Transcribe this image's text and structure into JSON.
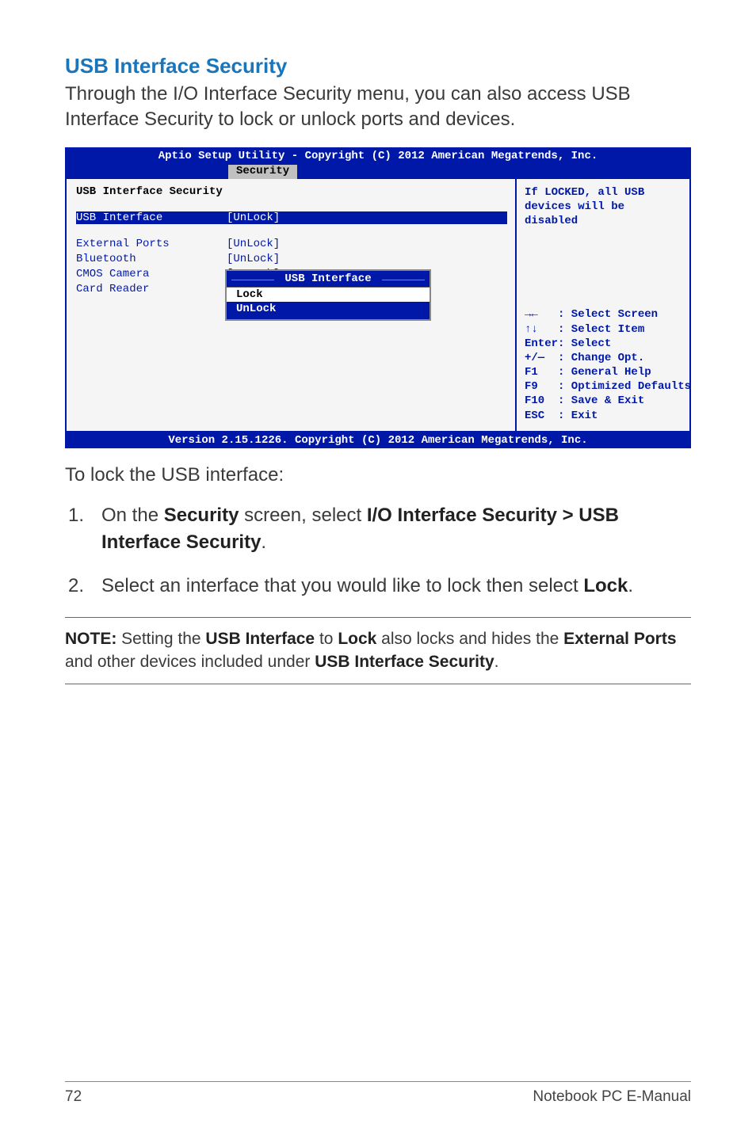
{
  "heading": "USB Interface Security",
  "intro": "Through the I/O Interface Security menu, you can also access USB Interface Security to lock or unlock ports and devices.",
  "bios": {
    "topline": "Aptio Setup Utility - Copyright (C) 2012 American Megatrends, Inc.",
    "tab": "Security",
    "left": {
      "section": "USB Interface Security",
      "rows": [
        {
          "label": "USB Interface",
          "value": "[UnLock]",
          "hl": true
        },
        {
          "label": "External Ports",
          "value": "[UnLock]"
        },
        {
          "label": "Bluetooth",
          "value": "[UnLock]"
        },
        {
          "label": "CMOS Camera",
          "value": "[UnLock]"
        },
        {
          "label": "Card Reader",
          "value": ""
        }
      ]
    },
    "popup": {
      "title": "USB Interface",
      "items": [
        "Lock",
        "UnLock"
      ],
      "selected": 0
    },
    "right": {
      "help": "If LOCKED, all USB devices will be disabled",
      "legend": [
        "→←   : Select Screen",
        "↑↓   : Select Item",
        "Enter: Select",
        "+/—  : Change Opt.",
        "F1   : General Help",
        "F9   : Optimized Defaults",
        "F10  : Save & Exit",
        "ESC  : Exit"
      ]
    },
    "footer": "Version 2.15.1226. Copyright (C) 2012 American Megatrends, Inc."
  },
  "afterBios": "To lock the USB interface:",
  "steps": [
    {
      "num": "1.",
      "pre": "On the ",
      "b1": "Security",
      "mid1": " screen, select ",
      "b2": "I/O Interface Security > USB Interface Security",
      "post": "."
    },
    {
      "num": "2.",
      "pre": "Select an interface that you would like to lock then select ",
      "b1": "Lock",
      "post": "."
    }
  ],
  "note": {
    "label": "NOTE:",
    "t1": " Setting the ",
    "b1": "USB Interface",
    "t2": " to ",
    "b2": "Lock",
    "t3": " also locks and hides the ",
    "b3": "External Ports",
    "t4": " and other devices included under ",
    "b4": "USB Interface Security",
    "t5": "."
  },
  "footer": {
    "pageNum": "72",
    "title": "Notebook PC E-Manual"
  }
}
